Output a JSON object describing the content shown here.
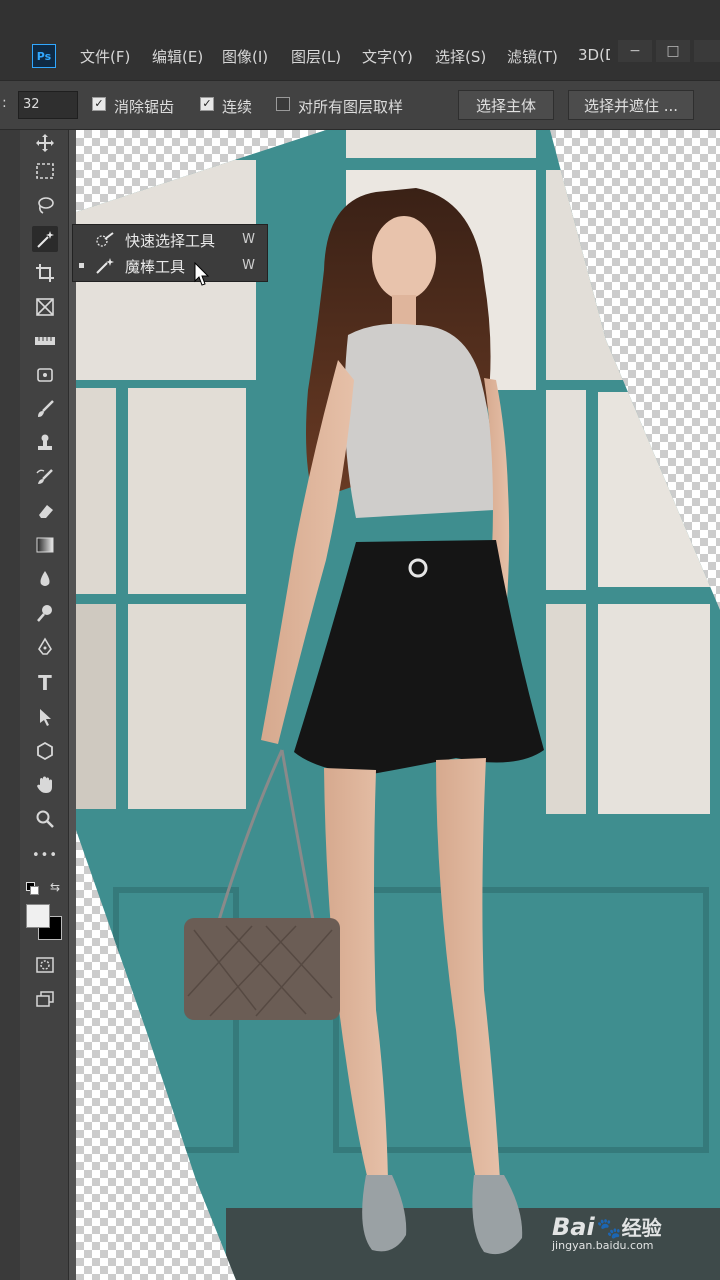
{
  "app": {
    "logo_text": "Ps"
  },
  "menu": {
    "items": [
      "文件(F)",
      "编辑(E)",
      "图像(I)",
      "图层(L)",
      "文字(Y)",
      "选择(S)",
      "滤镜(T)",
      "3D(D"
    ]
  },
  "window_controls": {
    "minimize": "−",
    "maximize": "□"
  },
  "options_bar": {
    "tolerance_value": "32",
    "antialias_label": "消除锯齿",
    "antialias_checked": true,
    "contiguous_label": "连续",
    "contiguous_checked": true,
    "sample_all_label": "对所有图层取样",
    "sample_all_checked": false,
    "select_subject_label": "选择主体",
    "select_and_mask_label": "选择并遮住 ..."
  },
  "toolbar": {
    "tools": [
      "move-tool-icon",
      "marquee-tool-icon",
      "lasso-tool-icon",
      "magic-wand-tool-icon",
      "crop-tool-icon",
      "frame-tool-icon",
      "ruler-tool-icon",
      "patch-tool-icon",
      "brush-tool-icon",
      "stamp-tool-icon",
      "history-brush-icon",
      "eraser-tool-icon",
      "gradient-tool-icon",
      "blur-tool-icon",
      "dodge-tool-icon",
      "pen-tool-icon",
      "type-tool-icon",
      "path-select-tool-icon",
      "shape-tool-icon",
      "hand-tool-icon",
      "zoom-tool-icon",
      "more-tools-icon"
    ],
    "type_tool_glyph": "T",
    "more_glyph": "•••",
    "foreground_color": "#f0f0f0",
    "background_color": "#000000"
  },
  "flyout": {
    "items": [
      {
        "label": "快速选择工具",
        "key": "W",
        "selected": false
      },
      {
        "label": "魔棒工具",
        "key": "W",
        "selected": true
      }
    ]
  },
  "watermark": {
    "brand": "Bai",
    "brand2": "经验",
    "url": "jingyan.baidu.com"
  },
  "colors": {
    "menubar": "#323232",
    "panel": "#424242",
    "teal_wall": "#3f8e8f",
    "glass": "#e4e0da"
  }
}
